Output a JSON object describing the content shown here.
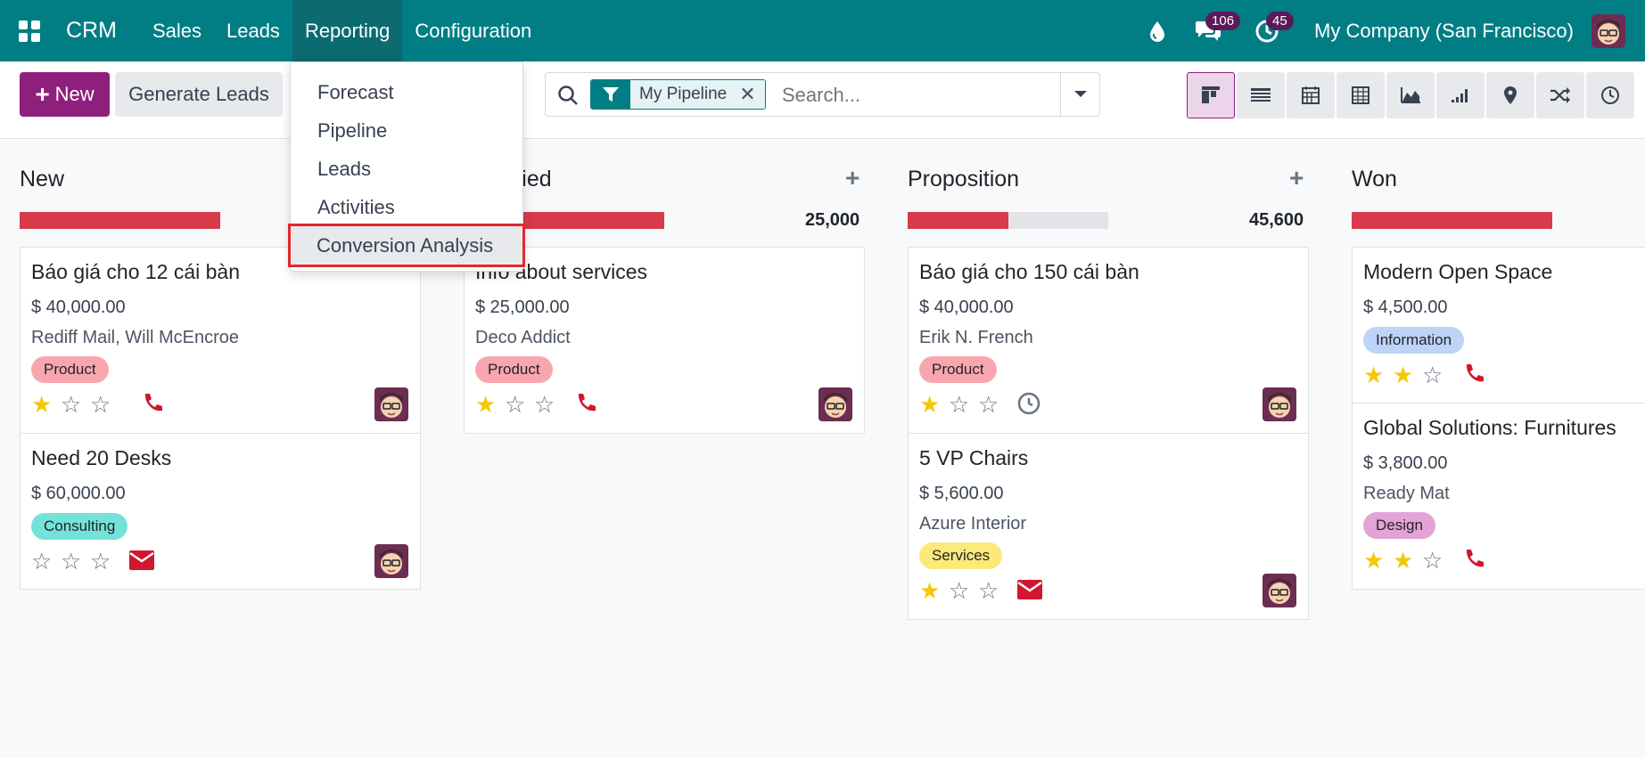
{
  "navbar": {
    "brand": "CRM",
    "menu": [
      "Sales",
      "Leads",
      "Reporting",
      "Configuration"
    ],
    "messages_badge": "106",
    "activities_badge": "45",
    "company": "My Company (San Francisco)"
  },
  "reporting_menu": {
    "items": [
      "Forecast",
      "Pipeline",
      "Leads",
      "Activities",
      "Conversion Analysis"
    ],
    "highlighted": "Conversion Analysis"
  },
  "control_panel": {
    "new_label": "New",
    "generate_label": "Generate Leads",
    "facet": "My Pipeline",
    "search_placeholder": "Search...",
    "views": [
      "kanban",
      "list",
      "calendar",
      "pivot",
      "graph",
      "cohort",
      "map",
      "activity-flow",
      "activity"
    ]
  },
  "columns": [
    {
      "title": "New",
      "total": "",
      "progress": 1.0,
      "cards": [
        {
          "name": "Báo giá cho 12 cái bàn",
          "amount": "$ 40,000.00",
          "partner": "Rediff Mail, Will McEncroe",
          "tag": "Product",
          "tag_color": "#f9a7ae",
          "stars": 1,
          "activity": "phone"
        },
        {
          "name": "Need 20 Desks",
          "amount": "$ 60,000.00",
          "partner": "",
          "tag": "Consulting",
          "tag_color": "#74e2d8",
          "stars": 0,
          "activity": "email"
        }
      ]
    },
    {
      "title": "Qualified",
      "total": "25,000",
      "progress": 1.0,
      "cards": [
        {
          "name": "Info about services",
          "amount": "$ 25,000.00",
          "partner": "Deco Addict",
          "tag": "Product",
          "tag_color": "#f9a7ae",
          "stars": 1,
          "activity": "phone"
        }
      ]
    },
    {
      "title": "Proposition",
      "total": "45,600",
      "progress": 0.5,
      "cards": [
        {
          "name": "Báo giá cho 150 cái bàn",
          "amount": "$ 40,000.00",
          "partner": "Erik N. French",
          "tag": "Product",
          "tag_color": "#f9a7ae",
          "stars": 1,
          "activity": "clock"
        },
        {
          "name": "5 VP Chairs",
          "amount": "$ 5,600.00",
          "partner": "Azure Interior",
          "tag": "Services",
          "tag_color": "#fbe97a",
          "stars": 1,
          "activity": "email"
        }
      ]
    },
    {
      "title": "Won",
      "total": "",
      "progress": 1.0,
      "cards": [
        {
          "name": "Modern Open Space",
          "amount": "$ 4,500.00",
          "partner": "",
          "tag": "Information",
          "tag_color": "#bed3f8",
          "stars": 2,
          "activity": "phone"
        },
        {
          "name": "Global Solutions: Furnitures",
          "amount": "$ 3,800.00",
          "partner": "Ready Mat",
          "tag": "Design",
          "tag_color": "#e3a3d6",
          "stars": 2,
          "activity": "phone"
        }
      ]
    }
  ],
  "colors": {
    "navbar": "#017e84",
    "primary": "#8f1f7d",
    "progress_red": "#d73a49",
    "star": "#f3c80c",
    "activity_red": "#d1162f",
    "highlight_box": "#e0282e"
  }
}
